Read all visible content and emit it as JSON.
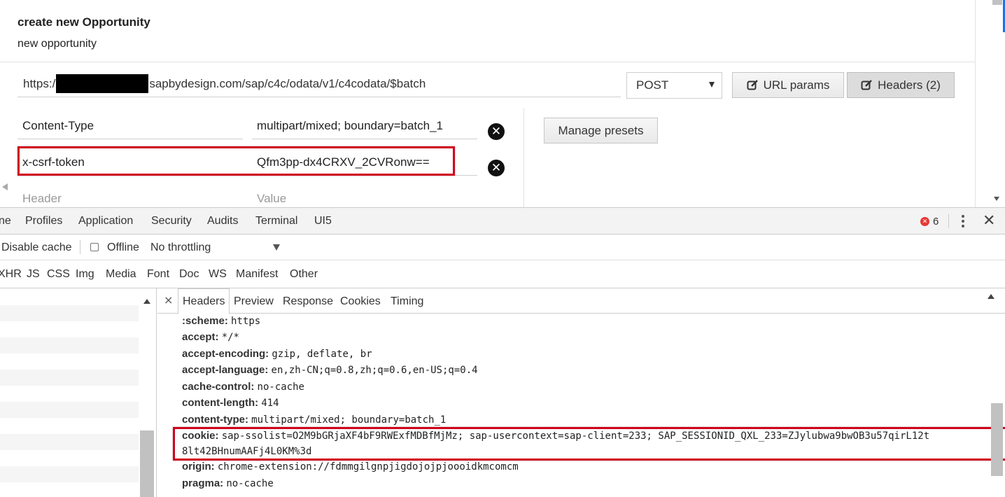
{
  "app": {
    "title": "create new Opportunity",
    "subtitle": "new opportunity",
    "url_prefix": "https:/",
    "url_suffix": "sapbydesign.com/sap/c4c/odata/v1/c4codata/$batch",
    "method": "POST",
    "url_params_label": "URL params",
    "headers_label": "Headers (2)",
    "manage_presets_label": "Manage presets",
    "headers": [
      {
        "name": "Content-Type",
        "value": "multipart/mixed; boundary=batch_1"
      },
      {
        "name": "x-csrf-token",
        "value": "Qfm3pp-dx4CRXV_2CVRonw=="
      }
    ],
    "header_placeholder": "Header",
    "value_placeholder": "Value",
    "remove_glyph": "✕"
  },
  "devtools": {
    "tabs": [
      "ne",
      "Profiles",
      "Application",
      "Security",
      "Audits",
      "Terminal",
      "UI5"
    ],
    "error_count": "6",
    "error_glyph": "✕",
    "close_glyph": "✕",
    "disable_cache_label": "Disable cache",
    "offline_label": "Offline",
    "throttling": "No throttling",
    "filters": [
      "XHR",
      "JS",
      "CSS",
      "Img",
      "Media",
      "Font",
      "Doc",
      "WS",
      "Manifest",
      "Other"
    ],
    "detail_close_glyph": "×",
    "detail_tabs": [
      "Headers",
      "Preview",
      "Response",
      "Cookies",
      "Timing"
    ],
    "request_headers": [
      {
        "key": ":scheme:",
        "value": "https"
      },
      {
        "key": "accept:",
        "value": "*/*"
      },
      {
        "key": "accept-encoding:",
        "value": "gzip, deflate, br"
      },
      {
        "key": "accept-language:",
        "value": "en,zh-CN;q=0.8,zh;q=0.6,en-US;q=0.4"
      },
      {
        "key": "cache-control:",
        "value": "no-cache"
      },
      {
        "key": "content-length:",
        "value": "414"
      },
      {
        "key": "content-type:",
        "value": "multipart/mixed; boundary=batch_1"
      },
      {
        "key": "cookie:",
        "value": "sap-ssolist=O2M9bGRjaXF4bF9RWExfMDBfMjMz; sap-usercontext=sap-client=233; SAP_SESSIONID_QXL_233=ZJylubwa9bwOB3u57qirL12t",
        "value_cont": "8lt42BHnumAAFj4L0KM%3d"
      },
      {
        "key": "origin:",
        "value": "chrome-extension://fdmmgilgnpjigdojojpjoooidkmcomcm"
      },
      {
        "key": "pragma:",
        "value": "no-cache"
      }
    ]
  },
  "colors": {
    "highlight": "#d0021b",
    "error": "#e53935"
  },
  "icons": {
    "edit": "edit-icon",
    "remove": "remove-header-icon",
    "error": "error-icon",
    "close": "close-icon",
    "more": "kebab-menu-icon"
  }
}
